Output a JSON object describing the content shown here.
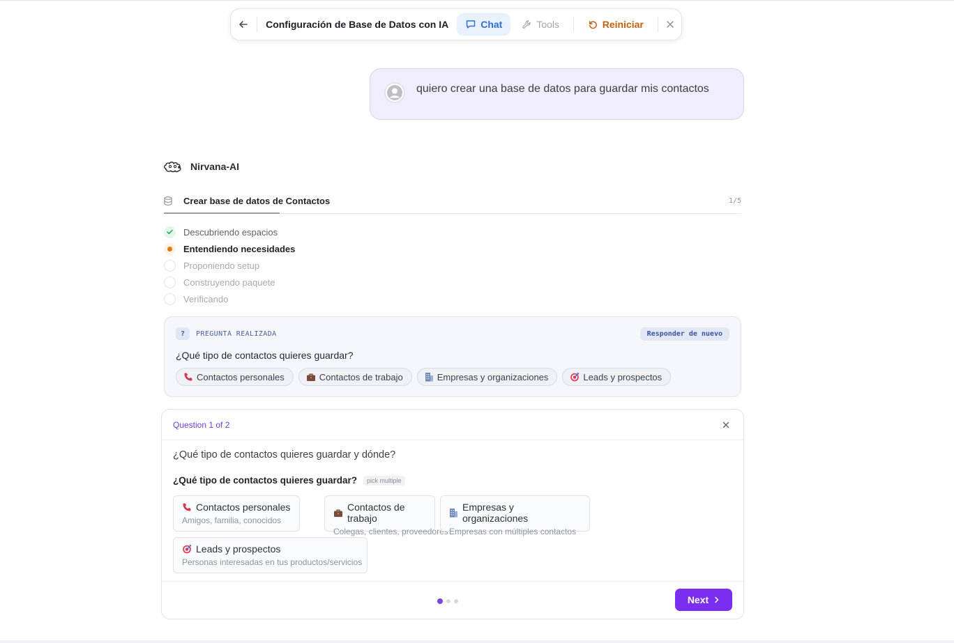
{
  "toolbar": {
    "title": "Configuración de Base de Datos con IA",
    "chat_label": "Chat",
    "tools_label": "Tools",
    "reset_label": "Reiniciar"
  },
  "user_message": {
    "text": "quiero crear una base de datos para guardar mis contactos"
  },
  "assistant": {
    "name": "Nirvana-AI"
  },
  "task": {
    "title": "Crear base de datos de Contactos",
    "count": "1/5",
    "progress_fraction": 0.2,
    "steps": [
      {
        "label": "Descubriendo espacios",
        "status": "done"
      },
      {
        "label": "Entendiendo necesidades",
        "status": "active"
      },
      {
        "label": "Proponiendo setup",
        "status": "pending"
      },
      {
        "label": "Construyendo paquete",
        "status": "pending"
      },
      {
        "label": "Verificando",
        "status": "pending"
      }
    ]
  },
  "asked_question": {
    "badge": "?",
    "label": "PREGUNTA REALIZADA",
    "reanswer_label": "Responder de nuevo",
    "question": "¿Qué tipo de contactos quieres guardar?",
    "answers": [
      {
        "icon": "phone-icon",
        "label": "Contactos personales"
      },
      {
        "icon": "briefcase-icon",
        "label": "Contactos de trabajo"
      },
      {
        "icon": "building-icon",
        "label": "Empresas y organizaciones"
      },
      {
        "icon": "target-icon",
        "label": "Leads y prospectos"
      }
    ]
  },
  "question_panel": {
    "step_label": "Question 1 of 2",
    "main_question": "¿Qué tipo de contactos quieres guardar y dónde?",
    "sub_question": "¿Qué tipo de contactos quieres guardar?",
    "pick_tag": "pick multiple",
    "options": [
      {
        "icon": "phone-icon",
        "title": "Contactos personales",
        "desc": "Amigos, familia, conocidos"
      },
      {
        "icon": "briefcase-icon",
        "title": "Contactos de trabajo",
        "desc": "Colegas, clientes, proveedores"
      },
      {
        "icon": "building-icon",
        "title": "Empresas y organizaciones",
        "desc": "Empresas con múltiples contactos"
      },
      {
        "icon": "target-icon",
        "title": "Leads y prospectos",
        "desc": "Personas interesadas en tus productos/servicios"
      }
    ],
    "current_page": 1,
    "total_pages": 3,
    "next_label": "Next"
  },
  "colors": {
    "accent": "#7a2ff0",
    "chat_active": "#2f6fd0",
    "reset": "#c2620c",
    "step_done": "#22a55a",
    "step_active": "#e07b12"
  }
}
